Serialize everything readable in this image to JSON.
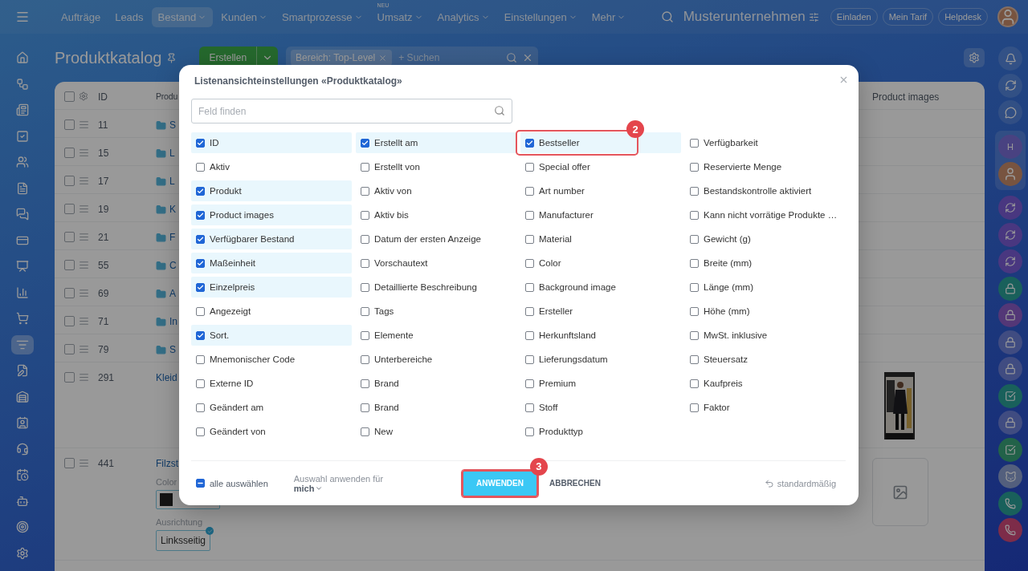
{
  "top_nav": {
    "items": [
      {
        "label": "Aufträge",
        "selected": false,
        "dropdown": false
      },
      {
        "label": "Leads",
        "selected": false,
        "dropdown": false
      },
      {
        "label": "Bestand",
        "selected": true,
        "dropdown": true
      },
      {
        "label": "Kunden",
        "selected": false,
        "dropdown": true
      },
      {
        "label": "Smartprozesse",
        "selected": false,
        "dropdown": true
      },
      {
        "label": "Umsatz",
        "selected": false,
        "dropdown": true,
        "tag": "NEU"
      },
      {
        "label": "Analytics",
        "selected": false,
        "dropdown": true
      },
      {
        "label": "Einstellungen",
        "selected": false,
        "dropdown": true
      },
      {
        "label": "Mehr",
        "selected": false,
        "dropdown": true
      }
    ],
    "company": "Musterunternehmen",
    "buttons": [
      "Einladen",
      "Mein Tarif",
      "Helpdesk"
    ]
  },
  "left_rail": [
    {
      "selected": false
    },
    {
      "selected": false
    },
    {
      "selected": false
    },
    {
      "selected": false
    },
    {
      "selected": false
    },
    {
      "selected": false
    },
    {
      "selected": false
    },
    {
      "selected": false
    },
    {
      "selected": false
    },
    {
      "selected": false
    },
    {
      "selected": false
    },
    {
      "selected": true
    },
    {
      "selected": false
    },
    {
      "selected": false
    },
    {
      "selected": false
    },
    {
      "selected": false
    },
    {
      "selected": false
    },
    {
      "selected": false
    },
    {
      "selected": false
    },
    {
      "selected": false
    }
  ],
  "page": {
    "title": "Produktkatalog",
    "create_button": "Erstellen",
    "filter": {
      "chip": "Bereich: Top-Level",
      "placeholder": "+ Suchen"
    }
  },
  "table": {
    "columns": [
      "ID",
      "Produ",
      "Product images"
    ],
    "all_checked": false,
    "rows": [
      {
        "id": "11",
        "name": "S",
        "kind": "folder",
        "checked": false
      },
      {
        "id": "15",
        "name": "L",
        "kind": "folder",
        "checked": false
      },
      {
        "id": "17",
        "name": "L",
        "kind": "folder",
        "checked": false
      },
      {
        "id": "19",
        "name": "K",
        "kind": "folder",
        "checked": false
      },
      {
        "id": "21",
        "name": "F",
        "kind": "folder",
        "checked": false
      },
      {
        "id": "55",
        "name": "C",
        "kind": "folder",
        "checked": false
      },
      {
        "id": "69",
        "name": "A",
        "kind": "folder",
        "checked": false
      },
      {
        "id": "71",
        "name": "In",
        "kind": "folder",
        "checked": false
      },
      {
        "id": "79",
        "name": "S",
        "kind": "folder",
        "checked": false
      },
      {
        "id": "291",
        "name": "Kleid",
        "kind": "product",
        "checked": false
      },
      {
        "id": "441",
        "name": "Filzst",
        "kind": "product",
        "checked": false,
        "image": {
          "kind": "placeholder"
        },
        "properties": [
          {
            "label": "Color",
            "kind": "swatch"
          },
          {
            "label": "Ausrichtung",
            "kind": "choice",
            "value": "Linksseitig"
          }
        ]
      }
    ]
  },
  "right_rail": {
    "avatar_letter": "H"
  },
  "dialog": {
    "title": "Listenansichteinstellungen «Produktkatalog»",
    "search_placeholder": "Feld finden",
    "columns": [
      [
        {
          "label": "ID",
          "checked": true
        },
        {
          "label": "Aktiv",
          "checked": false
        },
        {
          "label": "Produkt",
          "checked": true
        },
        {
          "label": "Product images",
          "checked": true
        },
        {
          "label": "Verfügbarer Bestand",
          "checked": true
        },
        {
          "label": "Maßeinheit",
          "checked": true
        },
        {
          "label": "Einzelpreis",
          "checked": true
        },
        {
          "label": "Angezeigt",
          "checked": false
        },
        {
          "label": "Sort.",
          "checked": true
        },
        {
          "label": "Mnemonischer Code",
          "checked": false
        },
        {
          "label": "Externe ID",
          "checked": false
        },
        {
          "label": "Geändert am",
          "checked": false
        },
        {
          "label": "Geändert von",
          "checked": false
        }
      ],
      [
        {
          "label": "Erstellt am",
          "checked": true
        },
        {
          "label": "Erstellt von",
          "checked": false
        },
        {
          "label": "Aktiv von",
          "checked": false
        },
        {
          "label": "Aktiv bis",
          "checked": false
        },
        {
          "label": "Datum der ersten Anzeige",
          "checked": false
        },
        {
          "label": "Vorschautext",
          "checked": false
        },
        {
          "label": "Detaillierte Beschreibung",
          "checked": false
        },
        {
          "label": "Tags",
          "checked": false
        },
        {
          "label": "Elemente",
          "checked": false
        },
        {
          "label": "Unterbereiche",
          "checked": false
        },
        {
          "label": "Brand",
          "checked": false
        },
        {
          "label": "Brand",
          "checked": false
        },
        {
          "label": "New",
          "checked": false
        }
      ],
      [
        {
          "label": "Bestseller",
          "checked": true,
          "callout": "2"
        },
        {
          "label": "Special offer",
          "checked": false
        },
        {
          "label": "Art number",
          "checked": false
        },
        {
          "label": "Manufacturer",
          "checked": false
        },
        {
          "label": "Material",
          "checked": false
        },
        {
          "label": "Color",
          "checked": false
        },
        {
          "label": "Background image",
          "checked": false
        },
        {
          "label": "Ersteller",
          "checked": false
        },
        {
          "label": "Herkunftsland",
          "checked": false
        },
        {
          "label": "Lieferungsdatum",
          "checked": false
        },
        {
          "label": "Premium",
          "checked": false
        },
        {
          "label": "Stoff",
          "checked": false
        },
        {
          "label": "Produkttyp",
          "checked": false
        }
      ],
      [
        {
          "label": "Verfügbarkeit",
          "checked": false
        },
        {
          "label": "Reservierte Menge",
          "checked": false
        },
        {
          "label": "Bestandskontrolle aktiviert",
          "checked": false
        },
        {
          "label": "Kann nicht vorrätige Produkte …",
          "checked": false
        },
        {
          "label": "Gewicht (g)",
          "checked": false
        },
        {
          "label": "Breite (mm)",
          "checked": false
        },
        {
          "label": "Länge (mm)",
          "checked": false
        },
        {
          "label": "Höhe (mm)",
          "checked": false
        },
        {
          "label": "MwSt. inklusive",
          "checked": false
        },
        {
          "label": "Steuersatz",
          "checked": false
        },
        {
          "label": "Kaufpreis",
          "checked": false
        },
        {
          "label": "Faktor",
          "checked": false
        }
      ]
    ],
    "select_all": {
      "label": "alle auswählen",
      "indeterminate": true
    },
    "apply_for": {
      "label": "Auswahl anwenden für",
      "value": "mich"
    },
    "apply_button": {
      "label": "ANWENDEN",
      "callout": "3"
    },
    "cancel_button": "ABBRECHEN",
    "reset_link": "standardmäßig"
  }
}
